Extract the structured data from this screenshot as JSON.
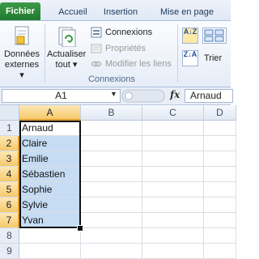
{
  "tabs": {
    "file": "Fichier",
    "home": "Accueil",
    "insert": "Insertion",
    "layout": "Mise en page"
  },
  "ribbon": {
    "external_data": [
      "Données",
      "externes ▾"
    ],
    "refresh": [
      "Actualiser",
      "tout ▾"
    ],
    "connections": "Connexions",
    "properties": "Propriétés",
    "edit_links": "Modifier les liens",
    "group_label": "Connexions",
    "sort": "Trier",
    "sort_az": "A↓Z",
    "sort_za": "Z↓A"
  },
  "formula_bar": {
    "name_box": "A1",
    "fx": "fx",
    "content": "Arnaud"
  },
  "grid": {
    "columns": [
      "A",
      "B",
      "C",
      "D"
    ],
    "rows": [
      "1",
      "2",
      "3",
      "4",
      "5",
      "6",
      "7",
      "8",
      "9"
    ],
    "col_a_values": [
      "Arnaud",
      "Claire",
      "Emilie",
      "Sébastien",
      "Sophie",
      "Sylvie",
      "Yvan",
      "",
      ""
    ]
  },
  "colors": {
    "file_tab": "#1f7a2c",
    "selection_fill": "#c5dcf3",
    "header_selected": "#f6c96a"
  }
}
